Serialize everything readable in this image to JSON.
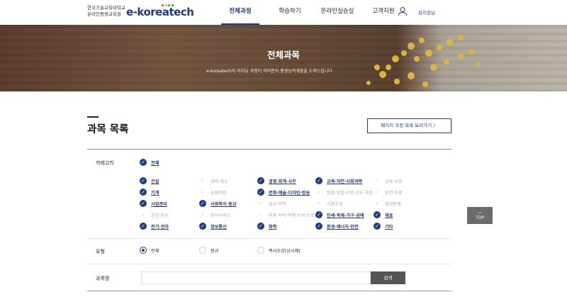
{
  "header": {
    "logo_korean": "한국기술교육대학교\n온라인평생교육원",
    "logo_english": "e-koreatech",
    "logo_dot_colors": [
      "#e23b3b",
      "#f3a521",
      "#37a84a",
      "#2f6bd1"
    ],
    "nav": [
      "전체과정",
      "학습하기",
      "온라인실습실",
      "고객지원"
    ],
    "active_nav": "전체과정",
    "user_name": "김지원님"
  },
  "banner": {
    "title": "전체과목",
    "subtitle": "e-koreatech의 이러닝 과정이 여러분의 평생능력개발을 도와드립니다"
  },
  "page": {
    "title": "과목 목록",
    "package_button": "패키지 과정 목록 보러가기 〉"
  },
  "filter": {
    "category_label": "카테고리",
    "all_label": "전체",
    "categories": [
      {
        "label": "건설",
        "checked": true
      },
      {
        "label": "경비·청소",
        "checked": false
      },
      {
        "label": "경영·회계·사무",
        "checked": true
      },
      {
        "label": "교육·자연·사회과학",
        "checked": true
      },
      {
        "label": "금융·보험",
        "checked": false
      },
      {
        "label": "기계",
        "checked": true
      },
      {
        "label": "농림어업",
        "checked": false
      },
      {
        "label": "문화·예술·디자인·방송",
        "checked": true
      },
      {
        "label": "법률·경찰·소방·교도·국방",
        "checked": false
      },
      {
        "label": "보건·의료",
        "checked": false
      },
      {
        "label": "사업관리",
        "checked": true
      },
      {
        "label": "사회복지·종교",
        "checked": true
      },
      {
        "label": "섬유·의복",
        "checked": false
      },
      {
        "label": "식품가공",
        "checked": false
      },
      {
        "label": "영업판매",
        "checked": false
      },
      {
        "label": "운전·운송",
        "checked": false
      },
      {
        "label": "음식서비스",
        "checked": false
      },
      {
        "label": "이용·숙박·여행·오락·스포츠",
        "checked": false
      },
      {
        "label": "인쇄·목재·가구·공예",
        "checked": true
      },
      {
        "label": "재료",
        "checked": true
      },
      {
        "label": "전기·전자",
        "checked": true
      },
      {
        "label": "정보통신",
        "checked": true
      },
      {
        "label": "화학",
        "checked": true
      },
      {
        "label": "환경·에너지·안전",
        "checked": true
      },
      {
        "label": "기타",
        "checked": true
      }
    ],
    "type_label": "유형",
    "types": [
      {
        "label": "전체",
        "selected": true
      },
      {
        "label": "정규",
        "selected": false
      },
      {
        "label": "즉시수강(상시제)",
        "selected": false
      }
    ],
    "name_label": "과목명",
    "search_value": "",
    "search_button": "검색"
  },
  "top_button": {
    "arrow": "︿",
    "label": "TOP"
  },
  "colors": {
    "accent": "#1e3a8a",
    "search_button": "#555555",
    "top_button": "#6b6b6b"
  }
}
